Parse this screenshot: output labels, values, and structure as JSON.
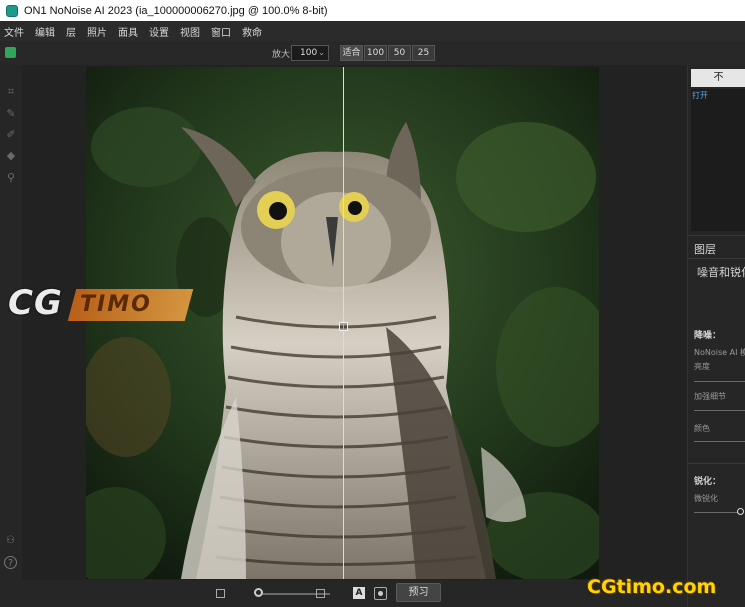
{
  "window": {
    "title": "ON1 NoNoise AI 2023 (ia_100000006270.jpg @ 100.0% 8-bit)"
  },
  "menu": [
    "文件",
    "编辑",
    "层",
    "照片",
    "面具",
    "设置",
    "视图",
    "窗口",
    "救命"
  ],
  "toolbar": {
    "zoom_label": "放大",
    "zoom_value": "100",
    "fit_label": "适合",
    "zoom_presets": [
      "100",
      "50",
      "25"
    ]
  },
  "bottom": {
    "preview_label": "预习",
    "a_label": "A"
  },
  "right_panel": {
    "top_button": "不",
    "open_label": "打开",
    "layers_title": "图层",
    "section_title": "噪音和锐化",
    "denoise_title": "降噪：",
    "nonoise_model": "NoNoise AI 模",
    "brightness_label": "亮度",
    "enhance_detail_label": "加强细节",
    "color_label": "颜色",
    "sharpen_title": "锐化：",
    "micro_sharpen_label": "微锐化"
  },
  "watermarks": {
    "left_main": "CG",
    "left_band": "TIMO",
    "bottom_right": "CGtimo.com"
  },
  "colors": {
    "accent_blue": "#5aa7e6",
    "watermark_yellow": "#ffd400",
    "app_icon": "#1d9a8e"
  }
}
